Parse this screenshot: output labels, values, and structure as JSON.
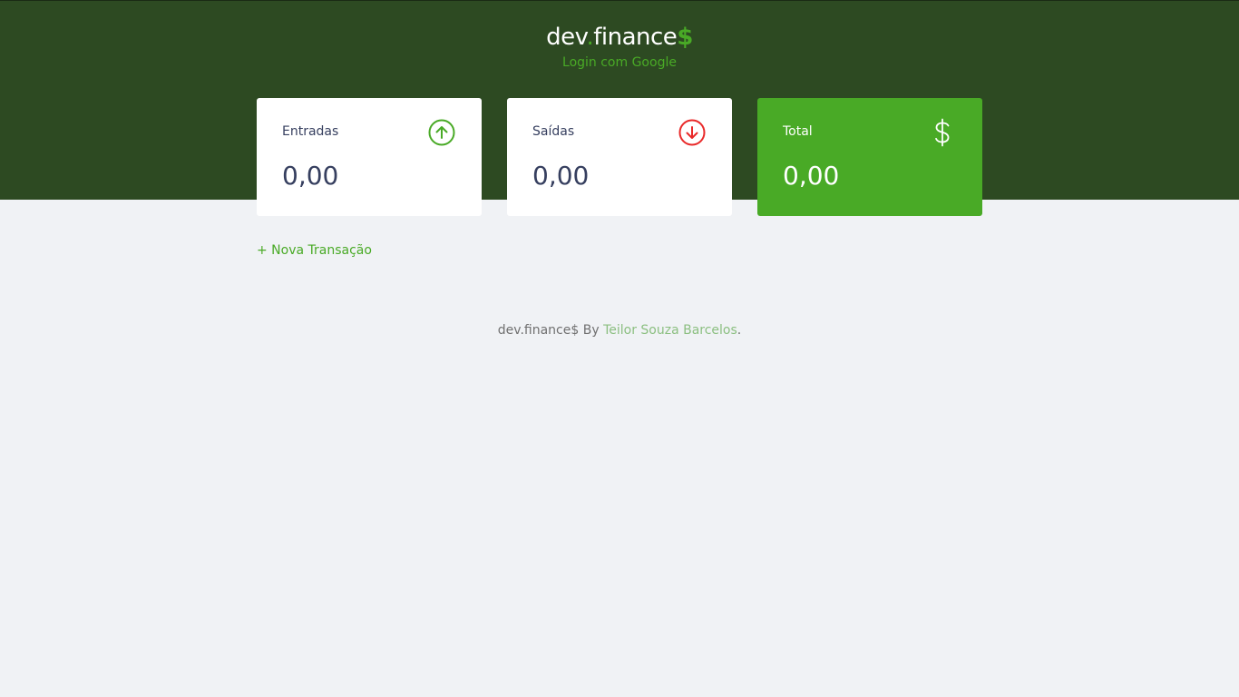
{
  "header": {
    "logo": {
      "part1": "dev",
      "dot": ".",
      "part2": "finance",
      "symbol": "$"
    },
    "login_link": "Login com Google"
  },
  "cards": {
    "income": {
      "title": "Entradas",
      "value": "0,00",
      "icon": "arrow-up-circle-icon"
    },
    "expense": {
      "title": "Saídas",
      "value": "0,00",
      "icon": "arrow-down-circle-icon"
    },
    "total": {
      "title": "Total",
      "value": "0,00",
      "icon": "dollar-sign-icon"
    }
  },
  "actions": {
    "new_transaction": "+ Nova Transação"
  },
  "footer": {
    "prefix": "dev.finance$ By ",
    "author": "Teilor Souza Barcelos",
    "suffix": "."
  },
  "colors": {
    "header_bg": "#2d4a22",
    "accent_green": "#49aa26",
    "expense_red": "#e92929",
    "page_bg": "#f0f2f5",
    "text_dark": "#363f5f"
  }
}
